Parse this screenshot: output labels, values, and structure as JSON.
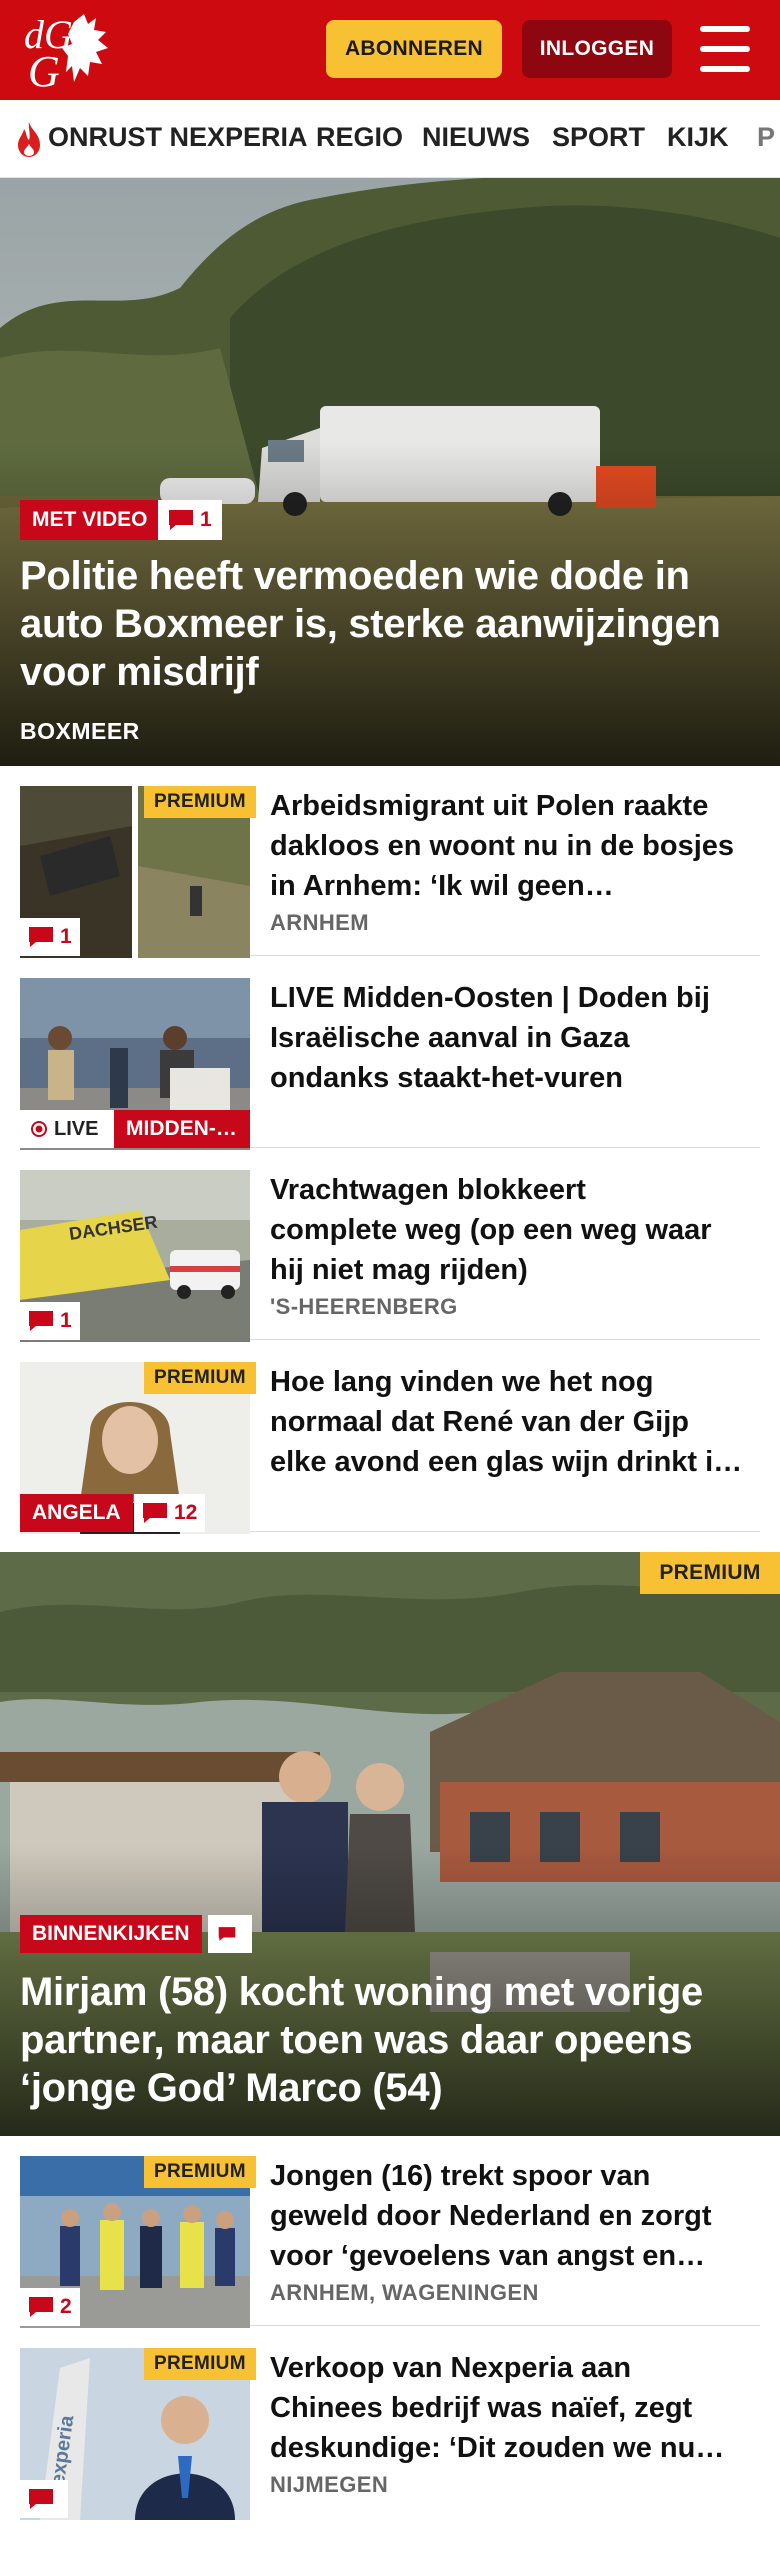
{
  "header": {
    "logo_text": "dG",
    "subscribe_label": "ABONNEREN",
    "login_label": "INLOGGEN"
  },
  "nav": {
    "items": [
      "ONRUST NEXPERIA",
      "REGIO",
      "NIEUWS",
      "SPORT",
      "KIJK",
      "P"
    ]
  },
  "hero1": {
    "badge": "MET VIDEO",
    "comments": "1",
    "title_lines": [
      "Politie heeft vermoeden wie dode in",
      "auto Boxmeer is, sterke aanwijzingen",
      "voor misdrijf"
    ],
    "location": "BOXMEER"
  },
  "articles": [
    {
      "premium": "PREMIUM",
      "comments": "1",
      "title_lines": [
        "Arbeidsmigrant uit Polen raakte",
        "dakloos en woont nu in de bosjes",
        "in Arnhem: ‘Ik wil geen…"
      ],
      "location": "ARNHEM"
    },
    {
      "live": "LIVE",
      "tag": "MIDDEN-…",
      "title_lines": [
        "LIVE Midden-Oosten | Doden bij",
        "Israëlische aanval in Gaza",
        "ondanks staakt-het-vuren"
      ]
    },
    {
      "comments": "1",
      "truck_text": "DACHSER",
      "title_lines": [
        "Vrachtwagen blokkeert",
        "complete weg (op een weg waar",
        "hij niet mag rijden)"
      ],
      "location": "'S-HEERENBERG"
    },
    {
      "premium": "PREMIUM",
      "tag": "ANGELA",
      "comments": "12",
      "title_lines": [
        "Hoe lang vinden we het nog",
        "normaal dat René van der Gijp",
        "elke avond een glas wijn drinkt i…"
      ]
    }
  ],
  "hero2": {
    "premium": "PREMIUM",
    "badge": "BINNENKIJKEN",
    "title_lines": [
      "Mirjam (58) kocht woning met vorige",
      "partner, maar toen was daar opeens",
      "‘jonge God’ Marco (54)"
    ]
  },
  "articles2": [
    {
      "premium": "PREMIUM",
      "comments": "2",
      "title_lines": [
        "Jongen (16) trekt spoor van",
        "geweld door Nederland en zorgt",
        "voor ‘gevoelens van angst en…"
      ],
      "location": "ARNHEM, WAGENINGEN"
    },
    {
      "premium": "PREMIUM",
      "sign_text": "nexperia",
      "title_lines": [
        "Verkoop van Nexperia aan",
        "Chinees bedrijf was naïef, zegt",
        "deskundige: ‘Dit zouden we nu…"
      ],
      "location": "NIJMEGEN"
    }
  ],
  "colors": {
    "brand_red": "#cc0a0f",
    "dark_red": "#8e0710",
    "yellow": "#f7c133",
    "badge_red": "#c7071a"
  }
}
